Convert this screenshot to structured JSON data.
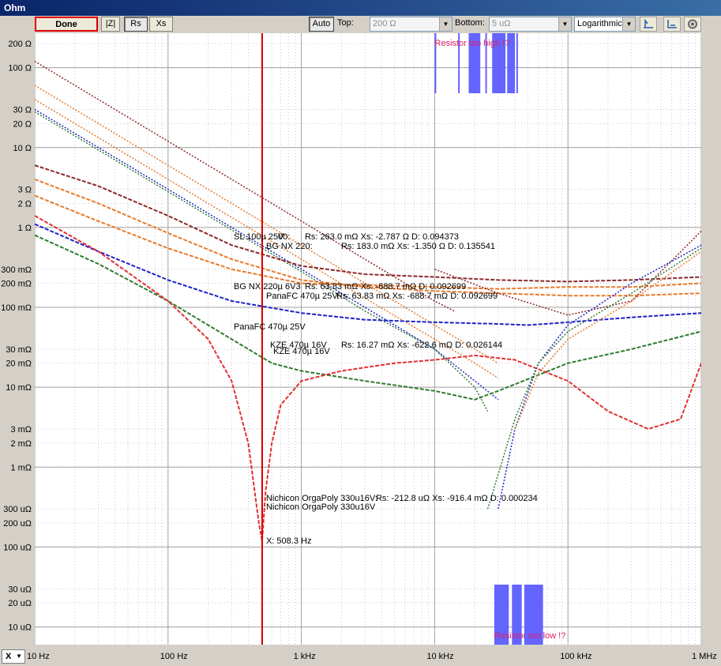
{
  "window": {
    "title": "Ohm"
  },
  "toolbar": {
    "done_label": "Done",
    "z_label": "|Z|",
    "rs_label": "Rs",
    "xs_label": "Xs",
    "auto_label": "Auto",
    "top_label": "Top:",
    "top_value": "200 Ω",
    "bottom_label": "Bottom:",
    "bottom_value": "5 uΩ",
    "scale_value": "Logarithmic"
  },
  "xaxis_selector": {
    "value": "X"
  },
  "colors": {
    "darkred": "#8b2a2a",
    "orange": "#e87a2a",
    "blue": "#1e22c8",
    "green": "#2e7a2e",
    "red": "#e23030",
    "marker": "#e00000",
    "warn": "#e0206a",
    "bar": "#6464ff"
  },
  "chart_data": {
    "type": "line",
    "xscale": "log",
    "yscale": "log",
    "xlim": [
      10,
      1000000
    ],
    "ylim": [
      6e-06,
      270
    ],
    "grid": true,
    "x_ticks": [
      "10 Hz",
      "100 Hz",
      "1 kHz",
      "10 kHz",
      "100 kHz",
      "1 MHz"
    ],
    "y_ticks": [
      "200 Ω",
      "100 Ω",
      "30 Ω",
      "20 Ω",
      "10 Ω",
      "3 Ω",
      "2 Ω",
      "1 Ω",
      "300 mΩ",
      "200 mΩ",
      "100 mΩ",
      "30 mΩ",
      "20 mΩ",
      "10 mΩ",
      "3 mΩ",
      "2 mΩ",
      "1 mΩ",
      "300 uΩ",
      "200 uΩ",
      "100 uΩ",
      "30 uΩ",
      "20 uΩ",
      "10 uΩ"
    ],
    "marker_x": 508.3,
    "marker_label": "X: 508.3 Hz",
    "warning_high": "Resistor too high !?",
    "warning_low": "Resistor too low !?",
    "annotations": [
      "SL 100µ 25V",
      "00:",
      "Rs: 263.0 mΩ  Xs: -2.787 Ω  D: 0.094373",
      "BG NX 220:",
      "Rs: 183.0 mΩ  Xs: -1.350 Ω  D: 0.135541",
      "BG NX 220µ 6V3",
      "Rs: 63.83 mΩ  Xs: -688.7 mΩ  D: 0.092699",
      "PanaFC 470µ 25V:",
      "Rs: 63.83 mΩ  Xs: -688.7 mΩ  D: 0.092699",
      "PanaFC 470µ 25V",
      "KZE 470µ 16V",
      "Rs: 16.27 mΩ  Xs: -622.6 mΩ  D: 0.026144",
      "KZE 470µ 16V",
      "Nichicon OrgaPoly 330u16V:",
      "Rs: -212.8 uΩ  Xs: -916.4 mΩ  D: 0.000234",
      "Nichicon OrgaPoly 330u16V"
    ],
    "series": [
      {
        "color": "darkred",
        "style": "dotted",
        "x": [
          10,
          100,
          1000,
          3000,
          6000,
          10000,
          14000
        ],
        "y": [
          120,
          12,
          1.2,
          0.4,
          0.2,
          0.12,
          0.09
        ]
      },
      {
        "color": "orange",
        "style": "dotted",
        "x": [
          10,
          100,
          1000,
          3000,
          10000,
          20000,
          30000
        ],
        "y": [
          60,
          6,
          0.6,
          0.2,
          0.06,
          0.03,
          0.02
        ]
      },
      {
        "color": "orange",
        "style": "dotted",
        "x": [
          10,
          100,
          1000,
          3000,
          10000,
          20000,
          30000
        ],
        "y": [
          40,
          4,
          0.4,
          0.13,
          0.04,
          0.02,
          0.013
        ]
      },
      {
        "color": "blue",
        "style": "dotted",
        "x": [
          10,
          100,
          1000,
          3000,
          10000,
          20000,
          30000
        ],
        "y": [
          30,
          3,
          0.3,
          0.1,
          0.03,
          0.012,
          0.007
        ]
      },
      {
        "color": "green",
        "style": "dotted",
        "x": [
          10,
          100,
          1000,
          3000,
          10000,
          20000,
          25000
        ],
        "y": [
          28,
          2.8,
          0.28,
          0.09,
          0.03,
          0.01,
          0.005
        ]
      },
      {
        "color": "darkred",
        "style": "dashed",
        "x": [
          10,
          30,
          100,
          300,
          1000,
          3000,
          10000,
          30000,
          100000,
          300000,
          1000000
        ],
        "y": [
          6,
          3.3,
          1.4,
          0.6,
          0.33,
          0.26,
          0.24,
          0.22,
          0.21,
          0.22,
          0.24
        ]
      },
      {
        "color": "orange",
        "style": "dashed",
        "x": [
          10,
          30,
          100,
          300,
          1000,
          3000,
          10000,
          30000,
          100000,
          300000,
          1000000
        ],
        "y": [
          4,
          2,
          0.85,
          0.4,
          0.22,
          0.18,
          0.16,
          0.15,
          0.14,
          0.14,
          0.15
        ]
      },
      {
        "color": "orange",
        "style": "dashed",
        "x": [
          10,
          30,
          100,
          300,
          1000,
          3000,
          10000,
          30000,
          100000,
          300000,
          1000000
        ],
        "y": [
          2.5,
          1.2,
          0.55,
          0.3,
          0.2,
          0.19,
          0.18,
          0.17,
          0.18,
          0.18,
          0.2
        ]
      },
      {
        "color": "blue",
        "style": "dashed",
        "x": [
          10,
          30,
          100,
          300,
          1000,
          3000,
          10000,
          30000,
          50000,
          100000,
          300000,
          1000000
        ],
        "y": [
          1.1,
          0.5,
          0.22,
          0.12,
          0.085,
          0.07,
          0.065,
          0.062,
          0.06,
          0.065,
          0.075,
          0.085
        ]
      },
      {
        "color": "green",
        "style": "dashed",
        "x": [
          10,
          30,
          100,
          300,
          600,
          1000,
          3000,
          10000,
          20000,
          30000,
          100000,
          300000,
          1000000
        ],
        "y": [
          0.8,
          0.35,
          0.12,
          0.04,
          0.02,
          0.016,
          0.012,
          0.009,
          0.007,
          0.009,
          0.02,
          0.03,
          0.05
        ]
      },
      {
        "color": "red",
        "style": "dashed",
        "x": [
          10,
          30,
          100,
          200,
          300,
          400,
          480,
          508,
          540,
          600,
          700,
          1000,
          2000,
          5000,
          10000,
          20000,
          40000,
          100000,
          200000,
          400000,
          700000,
          1000000
        ],
        "y": [
          1.4,
          0.5,
          0.12,
          0.04,
          0.012,
          0.002,
          0.0002,
          0.00012,
          0.0005,
          0.002,
          0.006,
          0.012,
          0.016,
          0.02,
          0.022,
          0.025,
          0.022,
          0.012,
          0.005,
          0.003,
          0.004,
          0.02
        ]
      },
      {
        "color": "darkred",
        "style": "dotted",
        "x": [
          10000,
          30000,
          100000,
          300000,
          1000000
        ],
        "y": [
          0.3,
          0.15,
          0.08,
          0.12,
          0.9
        ]
      },
      {
        "color": "blue",
        "style": "dotted",
        "x": [
          30000,
          40000,
          60000,
          100000,
          300000,
          1000000
        ],
        "y": [
          0.0003,
          0.003,
          0.02,
          0.06,
          0.2,
          0.6
        ]
      },
      {
        "color": "green",
        "style": "dotted",
        "x": [
          25000,
          40000,
          60000,
          100000,
          300000,
          1000000
        ],
        "y": [
          0.0003,
          0.004,
          0.02,
          0.05,
          0.15,
          0.55
        ]
      },
      {
        "color": "orange",
        "style": "dotted",
        "x": [
          40000,
          60000,
          100000,
          300000,
          1000000
        ],
        "y": [
          0.003,
          0.015,
          0.04,
          0.12,
          0.5
        ]
      }
    ]
  }
}
